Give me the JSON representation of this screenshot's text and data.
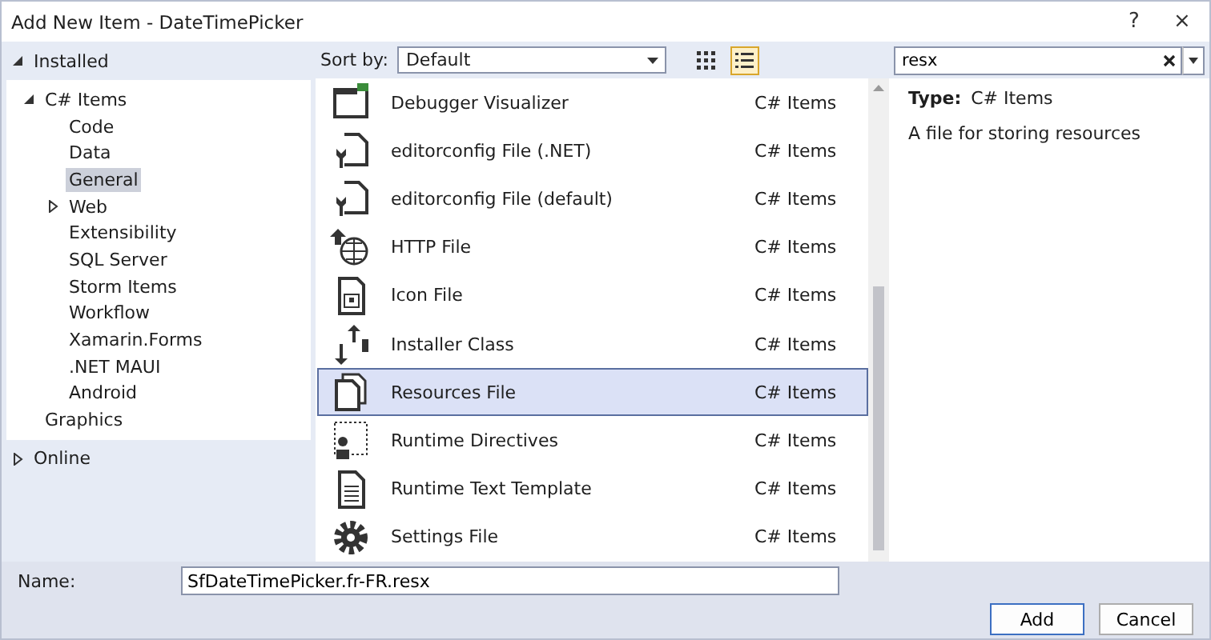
{
  "window": {
    "title": "Add New Item - DateTimePicker",
    "help": "?",
    "close": "×"
  },
  "sidebar": {
    "sections": [
      {
        "label": "Installed",
        "expanded": true,
        "tree": [
          {
            "label": "C# Items",
            "expanded": true,
            "selected": false,
            "children": [
              {
                "label": "Code",
                "selected": false
              },
              {
                "label": "Data",
                "selected": false
              },
              {
                "label": "General",
                "selected": true
              },
              {
                "label": "Web",
                "selected": false,
                "expanded": false
              },
              {
                "label": "Extensibility",
                "selected": false
              },
              {
                "label": "SQL Server",
                "selected": false
              },
              {
                "label": "Storm Items",
                "selected": false
              },
              {
                "label": "Workflow",
                "selected": false
              },
              {
                "label": "Xamarin.Forms",
                "selected": false
              },
              {
                "label": ".NET MAUI",
                "selected": false
              },
              {
                "label": "Android",
                "selected": false
              }
            ]
          },
          {
            "label": "Graphics",
            "selected": false
          }
        ]
      },
      {
        "label": "Online",
        "expanded": false
      }
    ]
  },
  "toolbar": {
    "sort_label": "Sort by:",
    "sort_value": "Default",
    "views": [
      {
        "kind": "grid",
        "selected": false
      },
      {
        "kind": "list",
        "selected": true
      }
    ]
  },
  "items": [
    {
      "name": "Debugger Visualizer",
      "category": "C# Items",
      "kind": "window",
      "selected": false
    },
    {
      "name": "editorconfig File (.NET)",
      "category": "C# Items",
      "kind": "wrench",
      "selected": false
    },
    {
      "name": "editorconfig File (default)",
      "category": "C# Items",
      "kind": "wrench",
      "selected": false
    },
    {
      "name": "HTTP File",
      "category": "C# Items",
      "kind": "globe",
      "selected": false
    },
    {
      "name": "Icon File",
      "category": "C# Items",
      "kind": "iconfile",
      "selected": false
    },
    {
      "name": "Installer Class",
      "category": "C# Items",
      "kind": "arrows",
      "selected": false
    },
    {
      "name": "Resources File",
      "category": "C# Items",
      "kind": "pages",
      "selected": true
    },
    {
      "name": "Runtime Directives",
      "category": "C# Items",
      "kind": "directives",
      "selected": false
    },
    {
      "name": "Runtime Text Template",
      "category": "C# Items",
      "kind": "doc",
      "selected": false
    },
    {
      "name": "Settings File",
      "category": "C# Items",
      "kind": "gear",
      "selected": false
    }
  ],
  "search": {
    "value": "resx"
  },
  "details": {
    "type_label": "Type:",
    "type_value": "C# Items",
    "description": "A file for storing resources"
  },
  "footer": {
    "name_label": "Name:",
    "name_value": "SfDateTimePicker.fr-FR.resx",
    "buttons": [
      {
        "label": "Add",
        "default": true
      },
      {
        "label": "Cancel",
        "default": false
      }
    ]
  }
}
